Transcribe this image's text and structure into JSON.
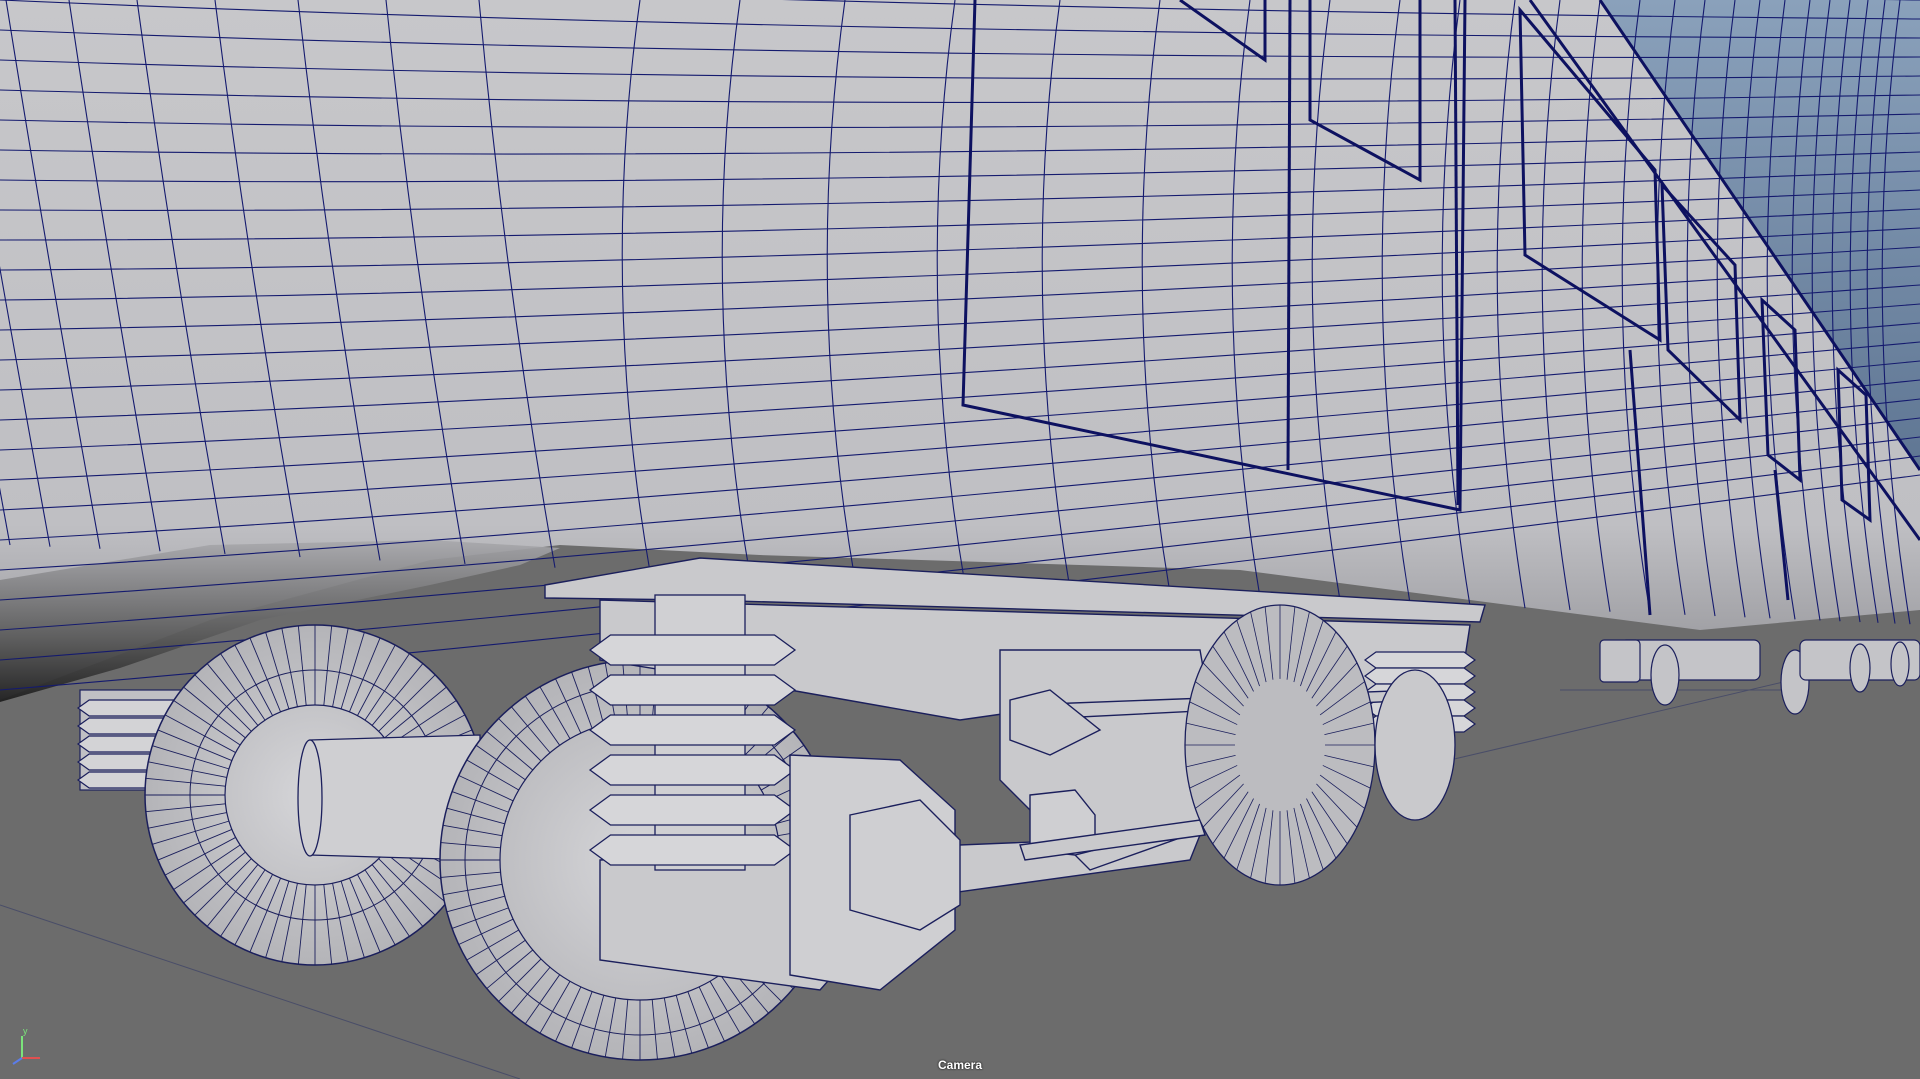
{
  "viewport": {
    "camera_label": "Camera",
    "axis_labels": {
      "y": "y",
      "z": "z",
      "x": "x"
    },
    "colors": {
      "sky_top": "#8aa1bb",
      "sky_bottom": "#5f7693",
      "ground": "#6c6c6c",
      "model_surface": "#c9c9cc",
      "wireframe": "#141a6e",
      "shadow": "#1b1b1b"
    },
    "icons": {
      "axis_gizmo": "axis-gizmo-icon"
    }
  }
}
